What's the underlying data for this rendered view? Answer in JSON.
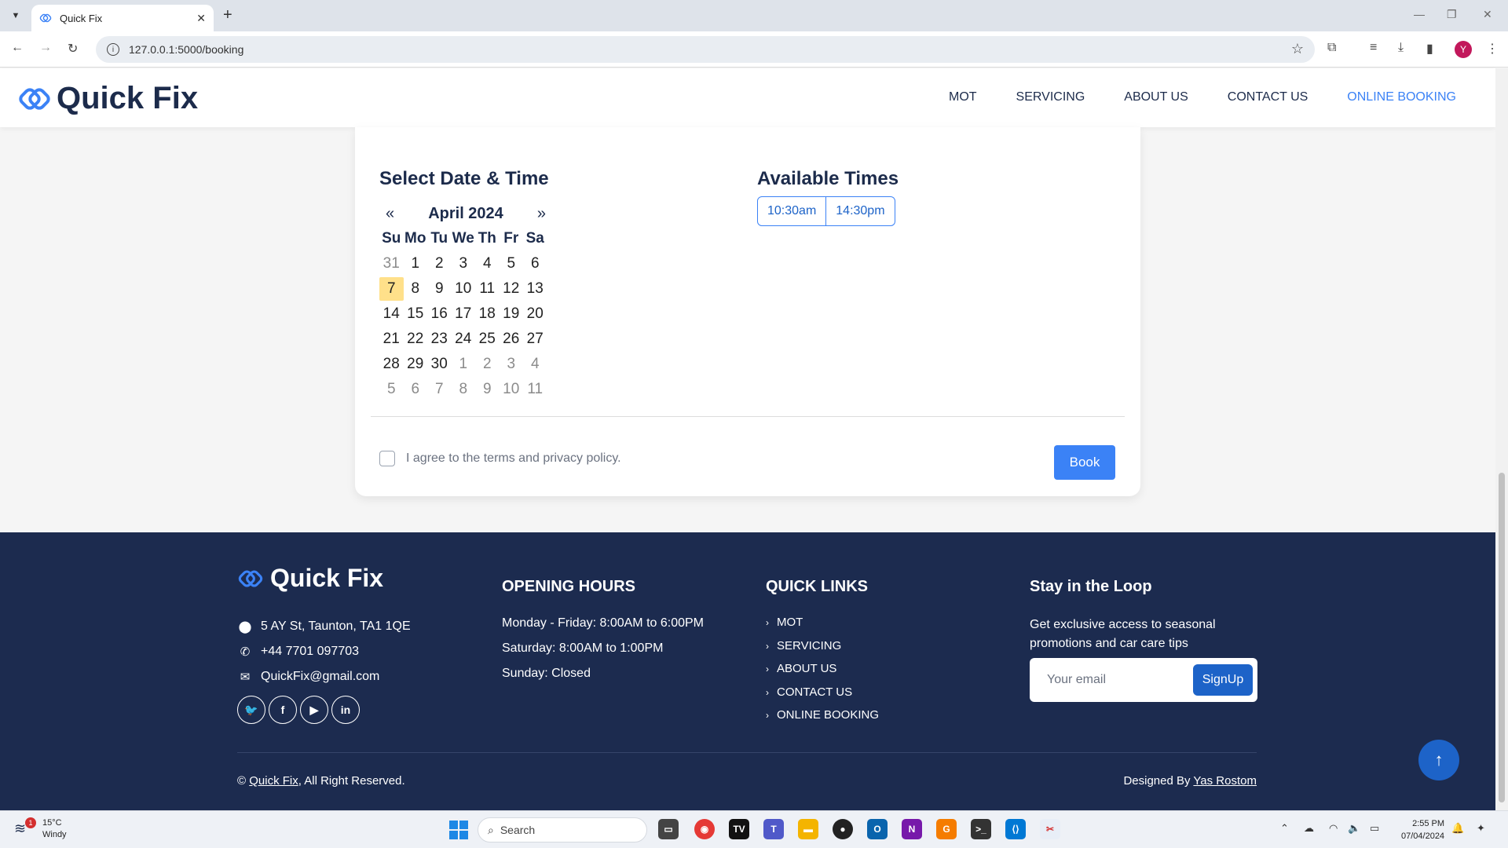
{
  "browser": {
    "tab_title": "Quick Fix",
    "url": "127.0.0.1:5000/booking"
  },
  "header": {
    "brand": "Quick Fix",
    "nav": [
      "MOT",
      "SERVICING",
      "ABOUT US",
      "CONTACT US",
      "ONLINE BOOKING"
    ],
    "active_nav": "ONLINE BOOKING"
  },
  "booking": {
    "date_heading": "Select Date & Time",
    "times_heading": "Available Times",
    "calendar": {
      "prev": "«",
      "next": "»",
      "month": "April 2024",
      "weekdays": [
        "Su",
        "Mo",
        "Tu",
        "We",
        "Th",
        "Fr",
        "Sa"
      ],
      "days": [
        [
          "31",
          "1",
          "2",
          "3",
          "4",
          "5",
          "6"
        ],
        [
          "7",
          "8",
          "9",
          "10",
          "11",
          "12",
          "13"
        ],
        [
          "14",
          "15",
          "16",
          "17",
          "18",
          "19",
          "20"
        ],
        [
          "21",
          "22",
          "23",
          "24",
          "25",
          "26",
          "27"
        ],
        [
          "28",
          "29",
          "30",
          "1",
          "2",
          "3",
          "4"
        ],
        [
          "5",
          "6",
          "7",
          "8",
          "9",
          "10",
          "11"
        ]
      ],
      "selected": "7"
    },
    "times": [
      "10:30am",
      "14:30pm"
    ],
    "agree_label": "I agree to the terms and privacy policy.",
    "book_label": "Book"
  },
  "footer": {
    "brand": "Quick Fix",
    "address": "5 AY St, Taunton, TA1 1QE",
    "phone": "+44 7701 097703",
    "email": "QuickFix@gmail.com",
    "hours_heading": "OPENING HOURS",
    "hours": [
      "Monday - Friday: 8:00AM to 6:00PM",
      "Saturday: 8:00AM to 1:00PM",
      "Sunday: Closed"
    ],
    "links_heading": "QUICK LINKS",
    "links": [
      "MOT",
      "SERVICING",
      "ABOUT US",
      "CONTACT US",
      "ONLINE BOOKING"
    ],
    "loop_heading": "Stay in the Loop",
    "loop_text": "Get exclusive access to seasonal promotions and car care tips",
    "email_placeholder": "Your email",
    "signup_label": "SignUp",
    "copyright_prefix": "©",
    "copyright_link": "Quick Fix",
    "copyright_suffix": ", All Right Reserved.",
    "designed_prefix": "Designed By",
    "designer": "Yas Rostom"
  },
  "taskbar": {
    "weather_temp": "15°C",
    "weather_desc": "Windy",
    "weather_badge": "1",
    "search_placeholder": "Search",
    "time": "2:55 PM",
    "date": "07/04/2024"
  },
  "colors": {
    "accent": "#3b82f6",
    "navy": "#1c2b4f",
    "highlight": "#ffe08a"
  }
}
